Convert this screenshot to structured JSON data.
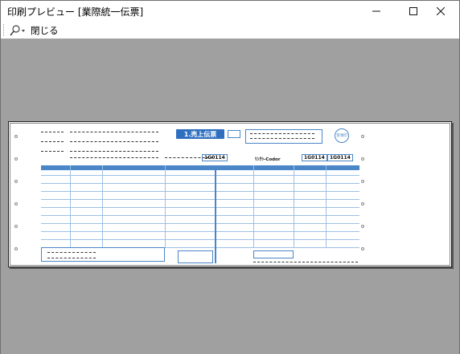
{
  "window": {
    "title": "印刷プレビュー [業際統一伝票]",
    "minimize_label": "─",
    "maximize_label": "☐",
    "close_label": "✕"
  },
  "toolbar": {
    "zoom_icon": "magnifier-dropdown-icon",
    "close_label": "閉じる"
  },
  "slip": {
    "title": "1.売上伝票",
    "stamp_label": "受領印",
    "code_left": "1G0114",
    "code_right": "1G0114",
    "header_code": "1G0114",
    "header_name": "ﾘﾝｸｼ-Codor"
  },
  "colors": {
    "preview_background": "#a0a0a0",
    "form_blue": "#2f6fc0"
  }
}
